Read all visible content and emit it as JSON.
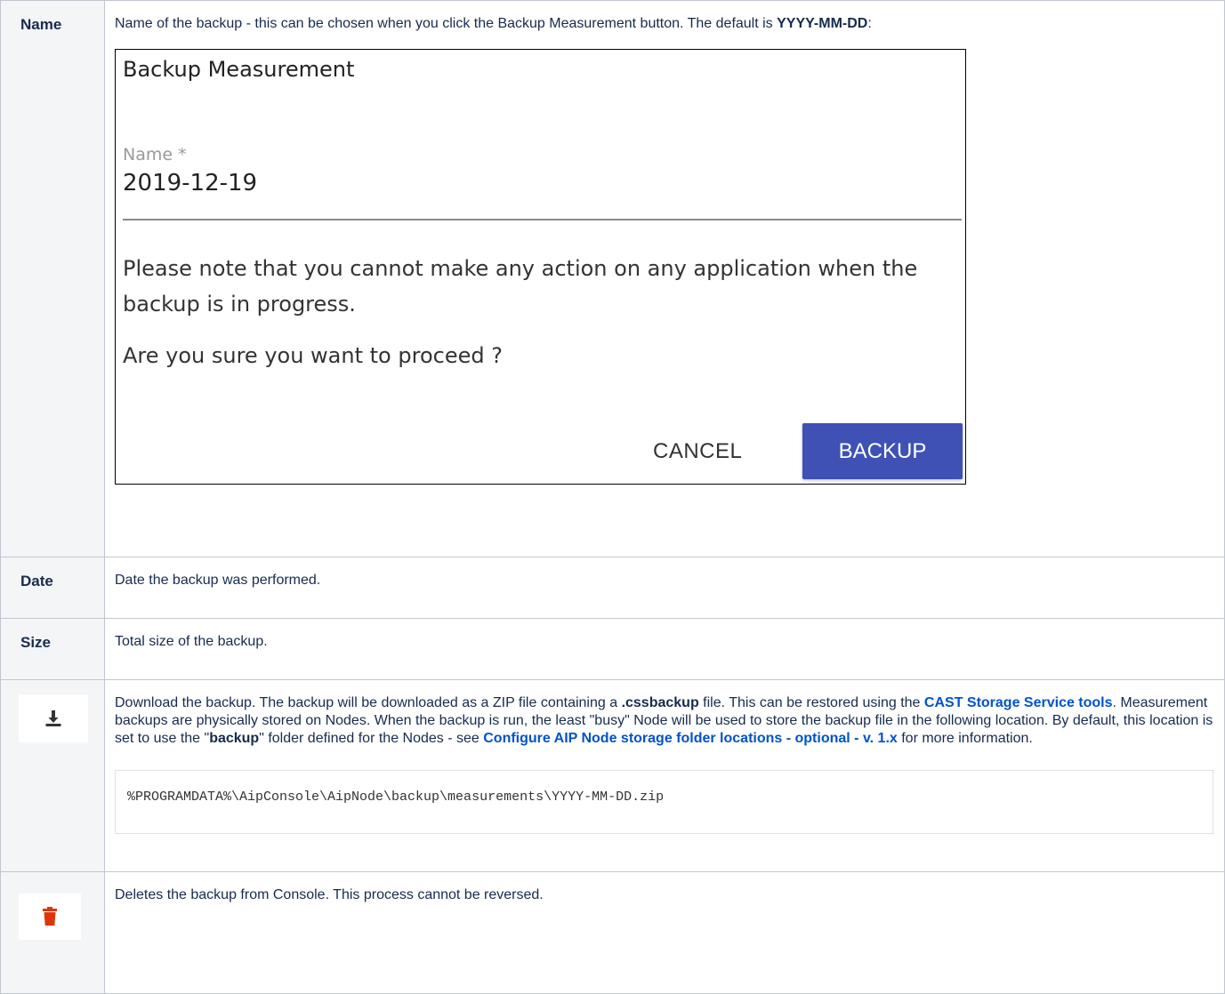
{
  "rows": {
    "name": {
      "label": "Name",
      "text_before": "Name of the backup - this can be chosen when you click the Backup Measurement button. The default is ",
      "text_bold": "YYYY-MM-DD",
      "text_after": ":"
    },
    "date": {
      "label": "Date",
      "text": "Date the backup was performed."
    },
    "size": {
      "label": "Size",
      "text": "Total size of the backup."
    },
    "download": {
      "icon": "download-icon",
      "t1": "Download the backup. The backup will be downloaded as a ZIP file containing a ",
      "b1": ".cssbackup",
      "t2": " file. This can be restored using the ",
      "link1": "CAST Storage Service tools",
      "t3": ". Measurement backups are physically stored on Nodes. When the backup is run, the least \"busy\" Node will be used to store the backup file in the following location. By default, this location is set to use the \"",
      "b2": "backup",
      "t4": "\" folder defined for the Nodes - see ",
      "link2": "Configure AIP Node storage folder locations - optional - v. 1.x",
      "t5": " for more information.",
      "code": "%PROGRAMDATA%\\AipConsole\\AipNode\\backup\\measurements\\YYYY-MM-DD.zip"
    },
    "delete": {
      "icon": "trash-icon",
      "text": "Deletes the backup from Console. This process cannot be reversed."
    }
  },
  "dialog": {
    "title": "Backup Measurement",
    "field_label": "Name *",
    "field_value": "2019-12-19",
    "note": "Please note that you cannot make any action on any application when the backup is in progress.",
    "confirm": "Are you sure you want to proceed ?",
    "cancel_label": "CANCEL",
    "backup_label": "BACKUP",
    "accent": "#3f51b5"
  },
  "colors": {
    "link": "#0052cc",
    "delete_icon": "#de350b",
    "label_bg": "#f4f5f7"
  }
}
